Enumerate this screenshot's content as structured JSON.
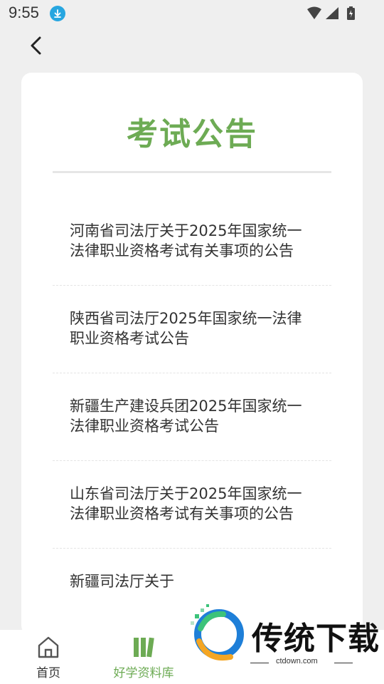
{
  "status_bar": {
    "time": "9:55"
  },
  "page": {
    "title": "考试公告"
  },
  "announcements": [
    {
      "text": "河南省司法厅关于2025年国家统一法律职业资格考试有关事项的公告"
    },
    {
      "text": "陕西省司法厅2025年国家统一法律职业资格考试公告"
    },
    {
      "text": "新疆生产建设兵团2025年国家统一法律职业资格考试公告"
    },
    {
      "text": "山东省司法厅关于2025年国家统一法律职业资格考试有关事项的公告"
    },
    {
      "text": "新疆司法厅关于"
    }
  ],
  "tabbar": {
    "tabs": [
      {
        "label": "首页",
        "icon": "home-icon"
      },
      {
        "label": "好学资料库",
        "icon": "library-icon",
        "active": true
      }
    ],
    "active_color": "#6dab54"
  },
  "watermark": {
    "brand": "传统下载",
    "url": "ctdown.com"
  },
  "colors": {
    "accent": "#6dab54",
    "background": "#efefef",
    "card": "#ffffff"
  }
}
